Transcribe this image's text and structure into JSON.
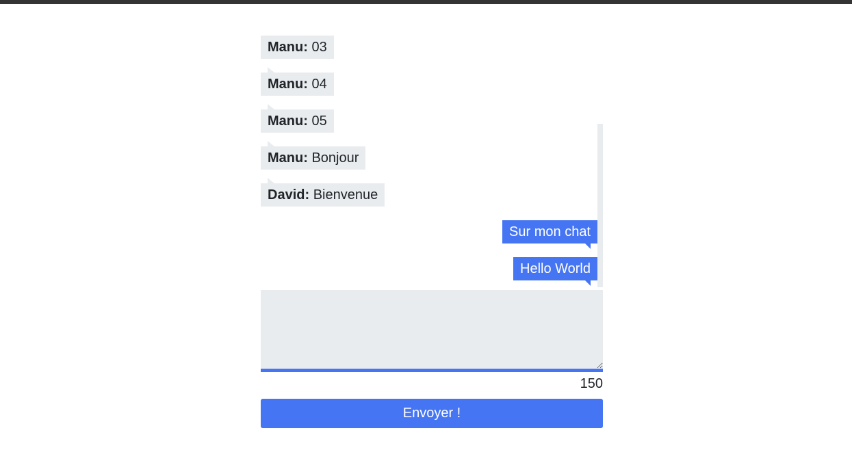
{
  "colors": {
    "accent": "#4575f3",
    "bubble_in": "#e9ecef",
    "top_bar": "#343434",
    "text": "#212529"
  },
  "messages": [
    {
      "author": "Manu:",
      "text": "03",
      "direction": "incoming"
    },
    {
      "author": "Manu:",
      "text": "04",
      "direction": "incoming"
    },
    {
      "author": "Manu:",
      "text": "05",
      "direction": "incoming"
    },
    {
      "author": "Manu:",
      "text": "Bonjour",
      "direction": "incoming"
    },
    {
      "author": "David:",
      "text": "Bienvenue",
      "direction": "incoming"
    },
    {
      "text": "Sur mon chat",
      "direction": "outgoing"
    },
    {
      "text": "Hello World",
      "direction": "outgoing"
    }
  ],
  "composer": {
    "value": "",
    "placeholder": "",
    "char_count": "150",
    "send_label": "Envoyer !"
  }
}
